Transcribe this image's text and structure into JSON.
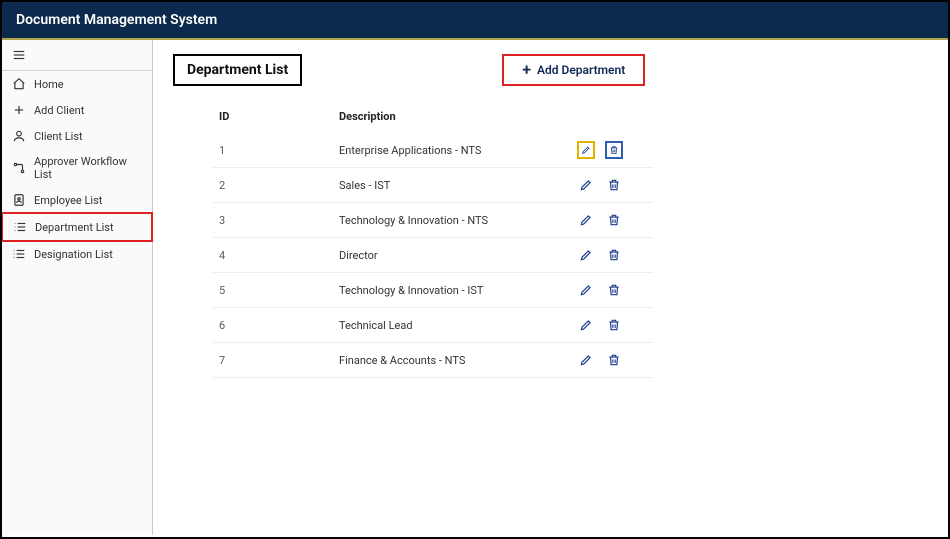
{
  "header": {
    "title": "Document Management System"
  },
  "sidebar": {
    "items": [
      {
        "label": "Home"
      },
      {
        "label": "Add Client"
      },
      {
        "label": "Client List"
      },
      {
        "label": "Approver Workflow List"
      },
      {
        "label": "Employee List"
      },
      {
        "label": "Department List"
      },
      {
        "label": "Designation List"
      }
    ]
  },
  "main": {
    "title": "Department List",
    "add_label": "Add Department",
    "columns": {
      "id": "ID",
      "desc": "Description"
    },
    "rows": [
      {
        "id": "1",
        "desc": "Enterprise Applications - NTS"
      },
      {
        "id": "2",
        "desc": "Sales - IST"
      },
      {
        "id": "3",
        "desc": "Technology & Innovation - NTS"
      },
      {
        "id": "4",
        "desc": "Director"
      },
      {
        "id": "5",
        "desc": "Technology & Innovation  - IST"
      },
      {
        "id": "6",
        "desc": "Technical Lead"
      },
      {
        "id": "7",
        "desc": "Finance & Accounts - NTS"
      }
    ]
  }
}
